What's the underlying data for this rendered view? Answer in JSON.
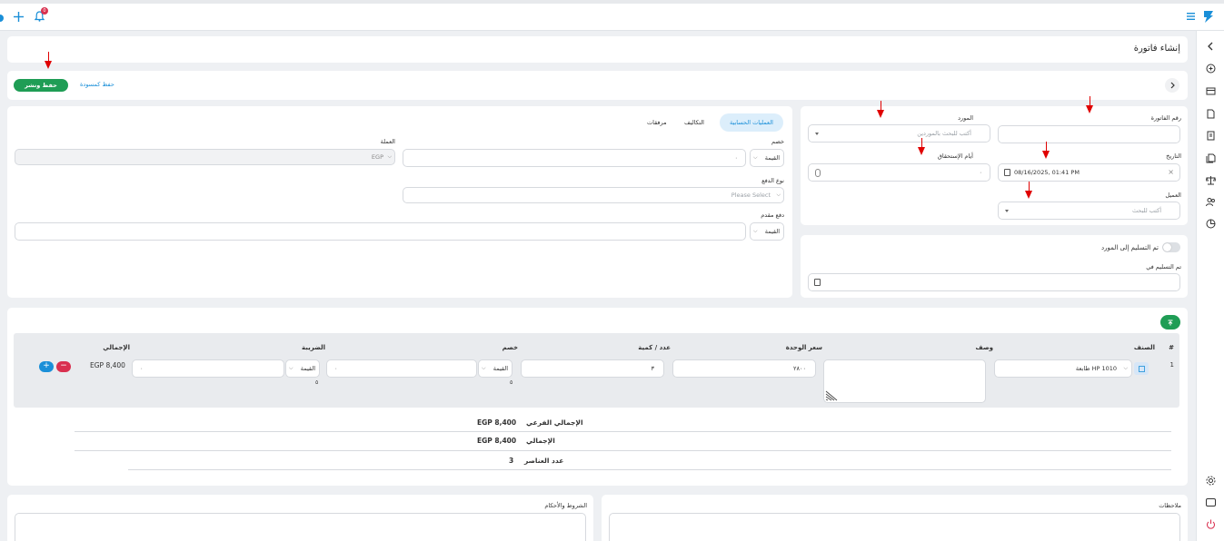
{
  "page": {
    "title": "إنشاء فاتورة"
  },
  "actions": {
    "save_publish": "حفظ ونشر",
    "save_draft": "حفظ كمسودة"
  },
  "topbar": {
    "notification_count": "0"
  },
  "invoice": {
    "number_label": "رقم الفاتورة",
    "supplier_label": "المورد",
    "supplier_placeholder": "أكتب للبحث بالموردين",
    "date_label": "التاريخ",
    "date_value": "08/16/2025, 01:41 PM",
    "due_days_label": "أيام الإستحقاق",
    "due_days_value": "٠",
    "client_label": "العميل",
    "client_placeholder": "أكتب للبحث"
  },
  "delivery": {
    "toggle_label": "تم التسليم إلى المورد",
    "delivered_at_label": "تم التسليم في"
  },
  "tabs": [
    {
      "label": "العمليات الحسابية"
    },
    {
      "label": "التكاليف"
    },
    {
      "label": "مرفقات"
    }
  ],
  "calc": {
    "discount_label": "خصم",
    "discount_type": "القيمة",
    "discount_value": "٠",
    "currency_label": "العملة",
    "currency_value": "EGP",
    "payment_type_label": "نوع الدفع",
    "payment_type_placeholder": "Please Select",
    "advance_label": "دفع مقدم",
    "advance_type": "القيمة"
  },
  "items": {
    "headers": {
      "index": "#",
      "product": "الصنف",
      "description": "وصف",
      "unit_price": "سعر الوحدة",
      "quantity": "عدد / كمية",
      "discount": "خصم",
      "tax": "الضريبة",
      "total": "الإجمالي"
    },
    "rows": [
      {
        "index": "1",
        "product": "طابعة HP 1010",
        "unit_price": "٢٨٠٠",
        "quantity": "٣",
        "discount_type": "القيمة",
        "discount_value": "٠",
        "discount_note": "٥",
        "tax_type": "القيمة",
        "tax_value": "٠",
        "tax_note": "٥",
        "total": "EGP 8,400"
      }
    ]
  },
  "summary": {
    "subtotal_label": "الإجمالي الفرعي",
    "subtotal_value": "EGP 8,400",
    "total_label": "الإجمالي",
    "total_value": "EGP 8,400",
    "count_label": "عدد العناصر",
    "count_value": "3"
  },
  "notes": {
    "notes_label": "ملاحظات",
    "terms_label": "الشروط والأحكام"
  },
  "colors": {
    "primary": "#1a8fd8",
    "success": "#1f9d55",
    "danger": "#d9304f",
    "accent_arrow": "#e00000"
  }
}
